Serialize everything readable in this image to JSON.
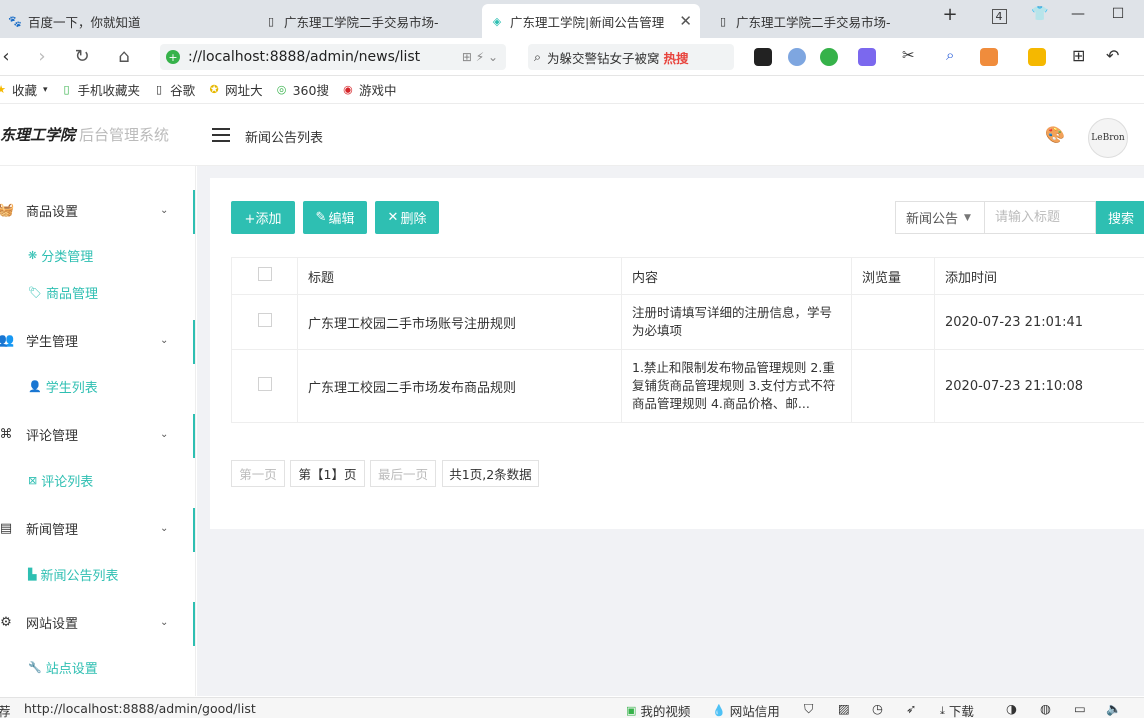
{
  "browser": {
    "tabs": [
      {
        "label": "百度一下，你就知道",
        "icon": "baidu-paw-icon"
      },
      {
        "label": "广东理工学院二手交易市场-",
        "icon": "page-icon"
      },
      {
        "label": "广东理工学院|新闻公告管理",
        "icon": "app-diamond-icon",
        "active": true
      },
      {
        "label": "广东理工学院二手交易市场-",
        "icon": "page-icon"
      }
    ],
    "tab_count": "4",
    "address": "://localhost:8888/admin/news/list",
    "search_text": "为躲交警钻女子被窝",
    "search_hot": "热搜",
    "bookmarks": [
      "收藏",
      "手机收藏夹",
      "谷歌",
      "网址大",
      "360搜",
      "游戏中"
    ],
    "status_url": "http://localhost:8888/admin/good/list",
    "status_left": "荐",
    "status_items": [
      "我的视频",
      "网站信用",
      "下载"
    ]
  },
  "header": {
    "school": "东理工学院",
    "system": "后台管理系统",
    "page_title": "新闻公告列表",
    "avatar_text": "LeBron"
  },
  "sidebar": {
    "groups": [
      {
        "label": "商品设置",
        "icon": "basket-icon",
        "subs": [
          {
            "label": "分类管理",
            "icon": "gear-icon"
          },
          {
            "label": "商品管理",
            "icon": "tag-icon"
          }
        ]
      },
      {
        "label": "学生管理",
        "icon": "users-icon",
        "subs": [
          {
            "label": "学生列表",
            "icon": "user-icon"
          }
        ]
      },
      {
        "label": "评论管理",
        "icon": "command-icon",
        "subs": [
          {
            "label": "评论列表",
            "icon": "grid-icon"
          }
        ]
      },
      {
        "label": "新闻管理",
        "icon": "news-icon",
        "subs": [
          {
            "label": "新闻公告列表",
            "icon": "doc-icon"
          }
        ]
      },
      {
        "label": "网站设置",
        "icon": "settings-icon",
        "subs": [
          {
            "label": "站点设置",
            "icon": "wrench-icon"
          }
        ]
      }
    ]
  },
  "toolbar": {
    "add": "+添加",
    "edit": "编辑",
    "delete": "删除",
    "filter_value": "新闻公告",
    "search_placeholder": "请输入标题",
    "search_button": "搜索"
  },
  "table": {
    "columns": [
      "标题",
      "内容",
      "浏览量",
      "添加时间"
    ],
    "rows": [
      {
        "title": "广东理工校园二手市场账号注册规则",
        "content": "注册时请填写详细的注册信息，学号为必填项",
        "views": "",
        "time": "2020-07-23 21:01:41"
      },
      {
        "title": "广东理工校园二手市场发布商品规则",
        "content": "1.禁止和限制发布物品管理规则 2.重复铺货商品管理规则 3.支付方式不符商品管理规则 4.商品价格、邮...",
        "views": "",
        "time": "2020-07-23 21:10:08"
      }
    ]
  },
  "pager": {
    "first": "第一页",
    "current": "第【1】页",
    "last": "最后一页",
    "summary": "共1页,2条数据"
  },
  "colors": {
    "accent": "#2ebfb2"
  }
}
